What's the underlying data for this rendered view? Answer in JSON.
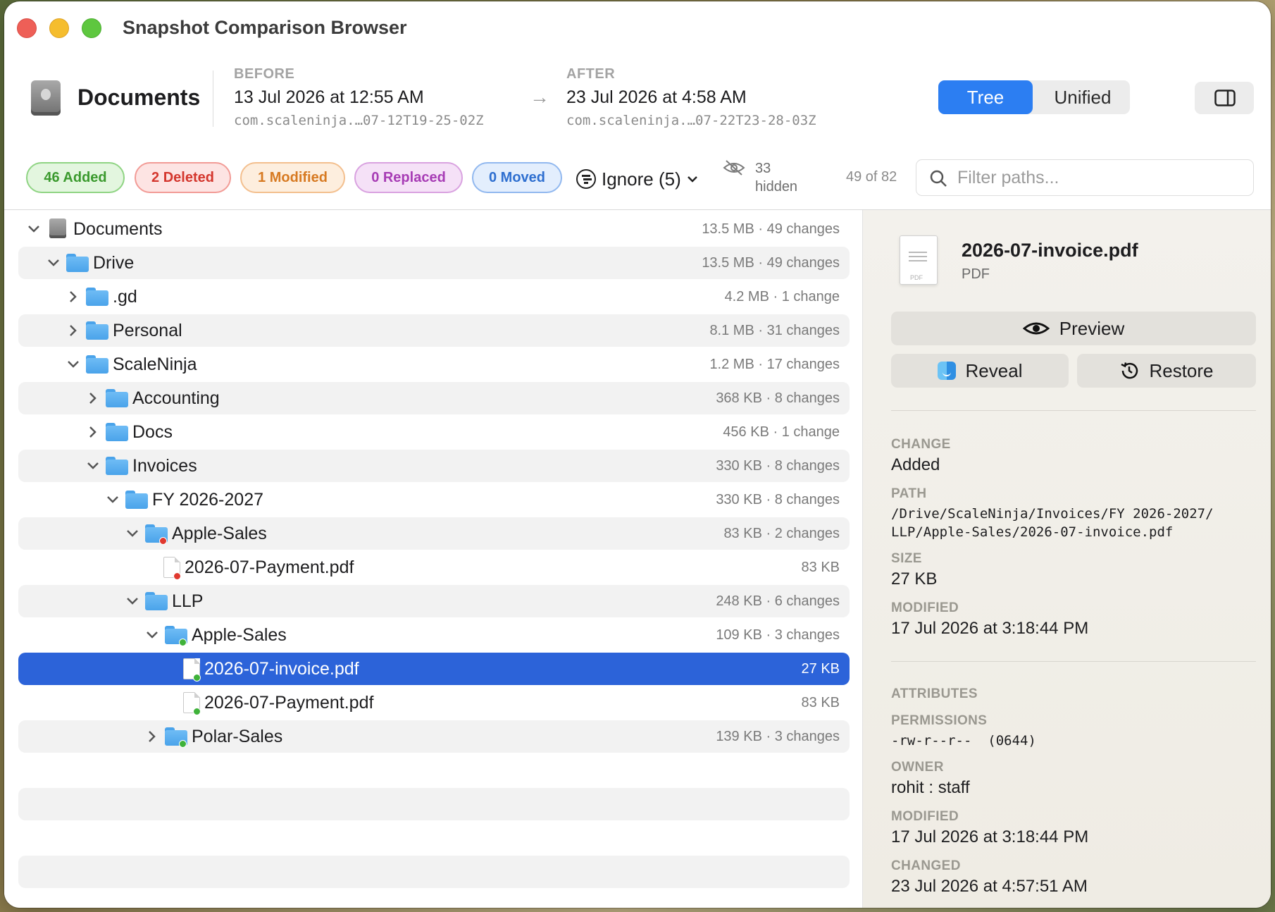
{
  "window": {
    "title": "Snapshot Comparison Browser"
  },
  "header": {
    "volume": "Documents",
    "before": {
      "label": "BEFORE",
      "date": "13 Jul 2026 at 12:55 AM",
      "id": "com.scaleninja.…07-12T19-25-02Z"
    },
    "after": {
      "label": "AFTER",
      "date": "23 Jul 2026 at 4:58 AM",
      "id": "com.scaleninja.…07-22T23-28-03Z"
    },
    "view_modes": [
      "Tree",
      "Unified"
    ],
    "active_view": "Tree"
  },
  "filters": {
    "added": "46 Added",
    "deleted": "2 Deleted",
    "modified": "1 Modified",
    "replaced": "0 Replaced",
    "moved": "0 Moved",
    "ignore": "Ignore (5)",
    "hidden_count": "33",
    "hidden_label": "hidden",
    "shown": "49 of 82",
    "search_placeholder": "Filter paths..."
  },
  "tree": [
    {
      "name": "Documents",
      "meta": "13.5 MB · 49 changes",
      "kind": "disk",
      "depth": 0,
      "expanded": true
    },
    {
      "name": "Drive",
      "meta": "13.5 MB · 49 changes",
      "kind": "folder",
      "depth": 1,
      "expanded": true
    },
    {
      "name": ".gd",
      "meta": "4.2 MB · 1 change",
      "kind": "folder",
      "depth": 2,
      "expanded": false
    },
    {
      "name": "Personal",
      "meta": "8.1 MB · 31 changes",
      "kind": "folder",
      "depth": 2,
      "expanded": false
    },
    {
      "name": "ScaleNinja",
      "meta": "1.2 MB · 17 changes",
      "kind": "folder",
      "depth": 2,
      "expanded": true
    },
    {
      "name": "Accounting",
      "meta": "368 KB · 8 changes",
      "kind": "folder",
      "depth": 3,
      "expanded": false
    },
    {
      "name": "Docs",
      "meta": "456 KB · 1 change",
      "kind": "folder",
      "depth": 3,
      "expanded": false
    },
    {
      "name": "Invoices",
      "meta": "330 KB · 8 changes",
      "kind": "folder",
      "depth": 3,
      "expanded": true
    },
    {
      "name": "FY 2026-2027",
      "meta": "330 KB · 8 changes",
      "kind": "folder",
      "depth": 4,
      "expanded": true
    },
    {
      "name": "Apple-Sales",
      "meta": "83 KB · 2 changes",
      "kind": "folder",
      "depth": 5,
      "expanded": true,
      "status": "deleted"
    },
    {
      "name": "2026-07-Payment.pdf",
      "meta": "83 KB",
      "kind": "file",
      "depth": 6,
      "status": "deleted"
    },
    {
      "name": "LLP",
      "meta": "248 KB · 6 changes",
      "kind": "folder",
      "depth": 5,
      "expanded": true
    },
    {
      "name": "Apple-Sales",
      "meta": "109 KB · 3 changes",
      "kind": "folder",
      "depth": 6,
      "expanded": true,
      "status": "added"
    },
    {
      "name": "2026-07-invoice.pdf",
      "meta": "27 KB",
      "kind": "file",
      "depth": 7,
      "status": "added",
      "selected": true
    },
    {
      "name": "2026-07-Payment.pdf",
      "meta": "83 KB",
      "kind": "file",
      "depth": 7,
      "status": "added"
    },
    {
      "name": "Polar-Sales",
      "meta": "139 KB · 3 changes",
      "kind": "folder",
      "depth": 6,
      "expanded": false,
      "status": "added"
    }
  ],
  "details": {
    "file_name": "2026-07-invoice.pdf",
    "file_type": "PDF",
    "icon_tag": "PDF",
    "preview_label": "Preview",
    "reveal_label": "Reveal",
    "restore_label": "Restore",
    "change_label": "CHANGE",
    "change_value": "Added",
    "path_label": "PATH",
    "path_line1": "/Drive/ScaleNinja/Invoices/FY 2026-2027/",
    "path_line2": "LLP/Apple-Sales/2026-07-invoice.pdf",
    "size_label": "SIZE",
    "size_value": "27 KB",
    "modified_label": "MODIFIED",
    "modified_value": "17 Jul 2026 at 3:18:44 PM",
    "attributes_label": "ATTRIBUTES",
    "permissions_label": "PERMISSIONS",
    "permissions_value": "-rw-r--r--  (0644)",
    "owner_label": "OWNER",
    "owner_value": "rohit : staff",
    "modified2_label": "MODIFIED",
    "modified2_value": "17 Jul 2026 at 3:18:44 PM",
    "changed_label": "CHANGED",
    "changed_value": "23 Jul 2026 at 4:57:51 AM"
  },
  "colors": {
    "accent": "#2c7ef2",
    "selection": "#2c63d9",
    "added": "#3fb23a",
    "deleted": "#e0392f"
  }
}
